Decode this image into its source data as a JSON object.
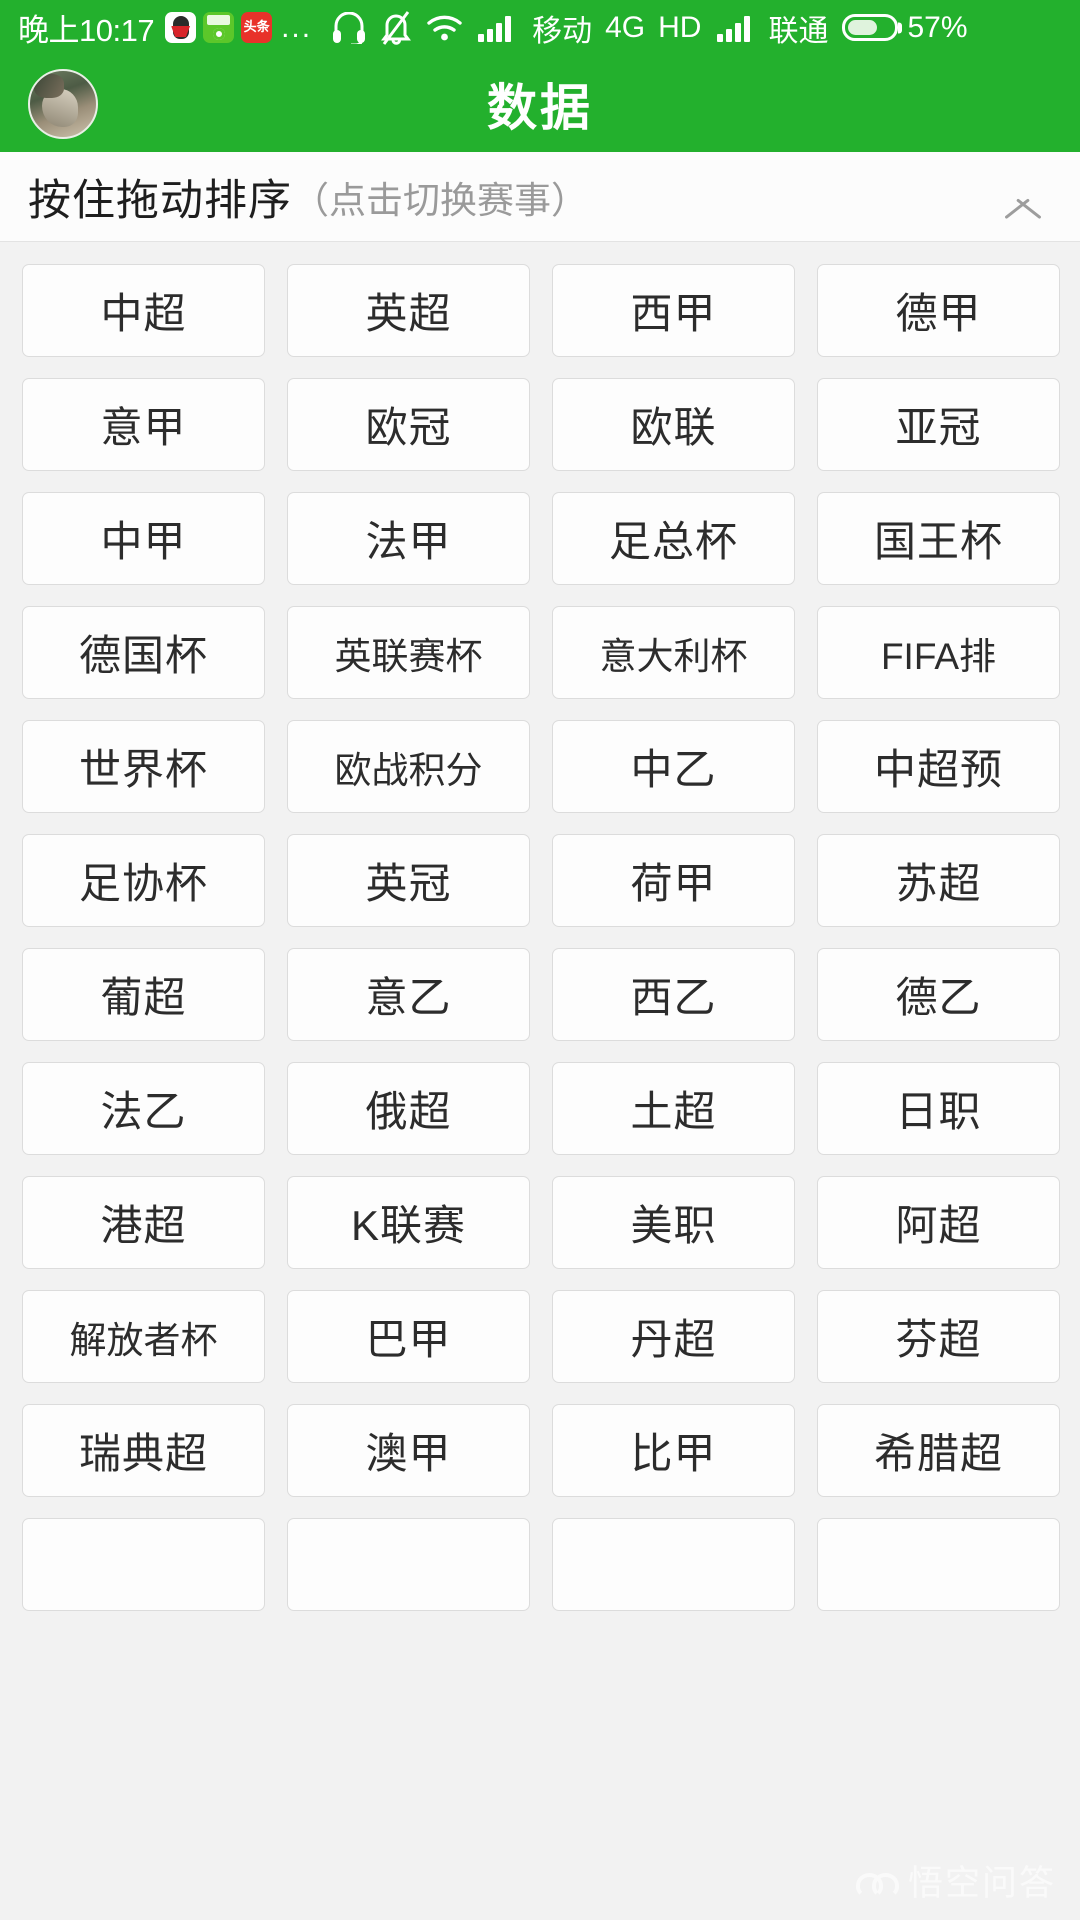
{
  "status_bar": {
    "time": "晚上10:17",
    "app_icons": [
      "qq-icon",
      "green-app-icon",
      "toutiao-icon"
    ],
    "overflow": "...",
    "icons": [
      "headset-icon",
      "bell-muted-icon",
      "wifi-icon",
      "signal-bars-icon"
    ],
    "carrier_1": "移动",
    "network_type": "4G",
    "hd_label": "HD",
    "carrier_2": "联通",
    "battery_percent": "57%",
    "battery_level": 57,
    "accent_color": "#23b02d"
  },
  "header": {
    "avatar": "user-avatar",
    "title": "数据"
  },
  "sort_bar": {
    "main_text": "按住拖动排序",
    "secondary_text": "（点击切换赛事）",
    "collapse_icon": "chevron-up-icon"
  },
  "leagues": [
    "中超",
    "英超",
    "西甲",
    "德甲",
    "意甲",
    "欧冠",
    "欧联",
    "亚冠",
    "中甲",
    "法甲",
    "足总杯",
    "国王杯",
    "德国杯",
    "英联赛杯",
    "意大利杯",
    "FIFA排",
    "世界杯",
    "欧战积分",
    "中乙",
    "中超预",
    "足协杯",
    "英冠",
    "荷甲",
    "苏超",
    "葡超",
    "意乙",
    "西乙",
    "德乙",
    "法乙",
    "俄超",
    "土超",
    "日职",
    "港超",
    "K联赛",
    "美职",
    "阿超",
    "解放者杯",
    "巴甲",
    "丹超",
    "芬超",
    "瑞典超",
    "澳甲",
    "比甲",
    "希腊超",
    "",
    "",
    "",
    ""
  ],
  "watermark": {
    "text": "悟空问答",
    "icon": "wukong-mascot-icon"
  }
}
